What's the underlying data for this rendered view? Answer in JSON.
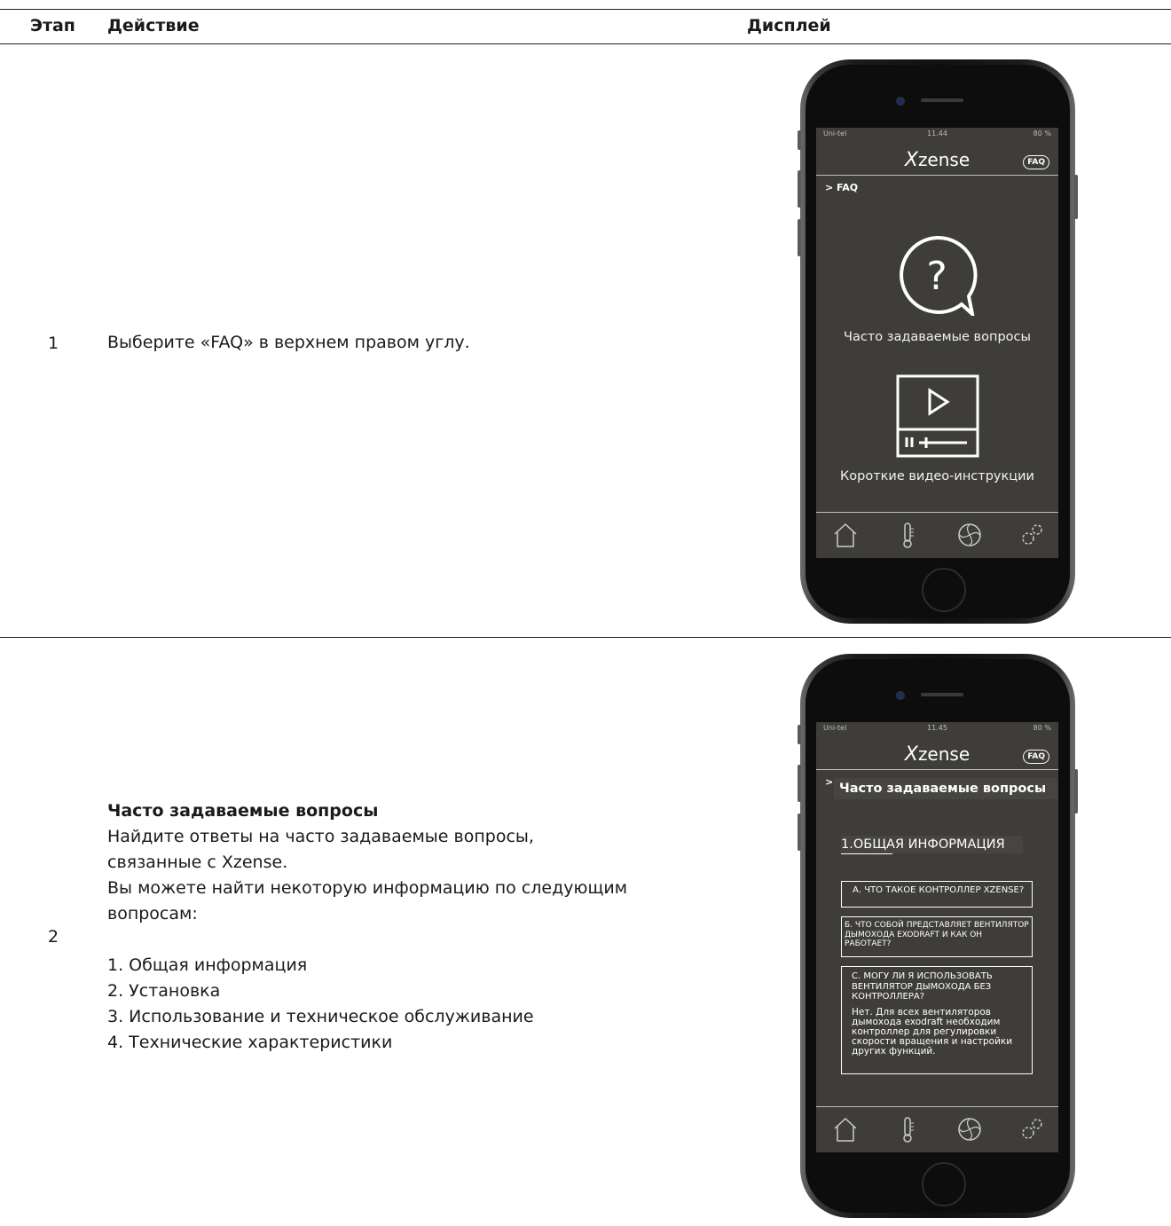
{
  "header": {
    "col_step": "Этап",
    "col_action": "Действие",
    "col_display": "Дисплей"
  },
  "rows": [
    {
      "step": "1",
      "action": "Выберите «FAQ» в верхнем правом углу."
    },
    {
      "step": "2",
      "title": "Часто задаваемые вопросы",
      "lines": [
        "Найдите ответы на часто задаваемые вопросы,",
        "связанные с Xzense.",
        "Вы можете найти некоторую информацию по следующим",
        "вопросам:"
      ],
      "list": [
        "1. Общая информация",
        "2. Установка",
        "3. Использование и техническое обслуживание",
        "4. Технические характеристики"
      ]
    }
  ],
  "phone1": {
    "carrier": "Uni-tel",
    "time": "11.44",
    "battery": "80 %",
    "logo": "zense",
    "logo_x": "X",
    "faq_badge": "FAQ",
    "breadcrumb": "> FAQ",
    "faq_label": "Часто задаваемые вопросы",
    "video_label": "Короткие видео-инструкции"
  },
  "phone2": {
    "carrier": "Uni-tel",
    "time": "11.45",
    "battery": "80 %",
    "logo": "zense",
    "logo_x": "X",
    "faq_badge": "FAQ",
    "breadcrumb": "> FAQ",
    "title": "Часто задаваемые вопросы",
    "section": "1.ОБЩАЯ ИНФОРМАЦИЯ",
    "qa": "А. ЧТО ТАКОЕ КОНТРОЛЛЕР XZENSE?",
    "qb": "Б. ЧТО СОБОЙ ПРЕДСТАВЛЯЕТ ВЕНТИЛЯТОР ДЫМОХОДА EXODRAFT И КАК ОН РАБОТАЕТ?",
    "qc": "C. МОГУ ЛИ Я ИСПОЛЬЗОВАТЬ ВЕНТИЛЯТОР ДЫМОХОДА БЕЗ КОНТРОЛЛЕРА?",
    "qc_answer": "Нет. Для всех вентиляторов дымохода exodraft необходим контроллер для регулировки скорости вращения и настройки других функций."
  },
  "icons": [
    "home-icon",
    "thermometer-icon",
    "fan-icon",
    "settings-icon",
    "question-bubble-icon",
    "video-player-icon"
  ]
}
